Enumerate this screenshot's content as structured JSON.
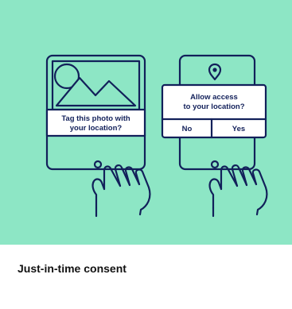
{
  "card": {
    "title": "Just-in-time consent",
    "background_color": "#8de6c5",
    "line_color": "#12205a"
  },
  "left_phone": {
    "image_icon": "landscape-photo-icon",
    "prompt_line1": "Tag this photo with",
    "prompt_line2": "your location?"
  },
  "right_phone": {
    "pin_icon": "location-pin-icon",
    "dialog_line1": "Allow access",
    "dialog_line2": "to your location?",
    "no_label": "No",
    "yes_label": "Yes"
  }
}
